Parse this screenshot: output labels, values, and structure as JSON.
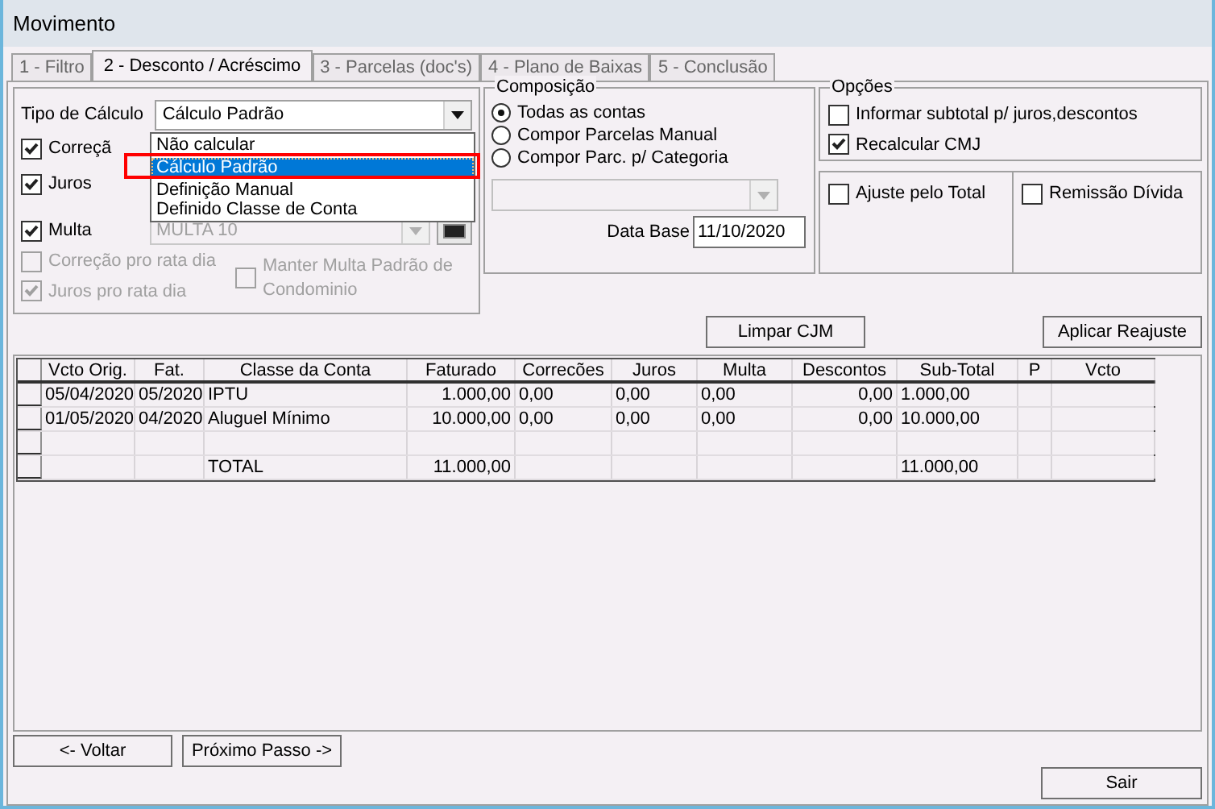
{
  "window": {
    "title": "Movimento"
  },
  "tabs": [
    {
      "label": "1 - Filtro",
      "selected": false
    },
    {
      "label": "2 - Desconto / Acréscimo",
      "selected": true
    },
    {
      "label": "3 - Parcelas (doc's)",
      "selected": false
    },
    {
      "label": "4 - Plano de Baixas",
      "selected": false
    },
    {
      "label": "5 - Conclusão",
      "selected": false
    }
  ],
  "calculo": {
    "label": "Tipo de Cálculo",
    "value": "Cálculo Padrão",
    "options": [
      {
        "label": "Não calcular",
        "selected": false
      },
      {
        "label": "Cálculo Padrão",
        "selected": true
      },
      {
        "label": "Definição Manual",
        "selected": false
      },
      {
        "label": "Definido Classe de Conta",
        "selected": false
      }
    ]
  },
  "checks": [
    {
      "label": "Correçã",
      "checked": true
    },
    {
      "label": "Juros",
      "checked": true
    },
    {
      "label": "Multa",
      "checked": true,
      "select": "MULTA 10"
    }
  ],
  "pro_rata": [
    {
      "label": "Correção pro rata dia",
      "checked": false,
      "disabled": true
    },
    {
      "label": "Juros pro rata dia",
      "checked": true,
      "disabled": true
    }
  ],
  "manter": {
    "label": "Manter Multa Padrão de Condominio",
    "checked": false,
    "disabled": true
  },
  "composicao": {
    "title": "Composição",
    "options": [
      {
        "label": "Todas as contas",
        "selected": true
      },
      {
        "label": "Compor Parcelas Manual",
        "selected": false
      },
      {
        "label": "Compor Parc. p/ Categoria",
        "selected": false
      }
    ],
    "data_base_label": "Data Base",
    "data_base": "11/10/2020"
  },
  "opcoes": {
    "title": "Opções",
    "checks": [
      {
        "label": "Informar subtotal p/ juros,descontos",
        "checked": false
      },
      {
        "label": "Recalcular CMJ",
        "checked": true
      }
    ]
  },
  "ajuste": {
    "label": "Ajuste pelo Total",
    "checked": false
  },
  "remissao": {
    "label": "Remissão Dívida",
    "checked": false
  },
  "limpar_button": "Limpar CJM",
  "aplicar_button": "Aplicar Reajuste",
  "table": {
    "columns": [
      "Vcto Orig.",
      "Fat.",
      "Classe da Conta",
      "Faturado",
      "Correcões",
      "Juros",
      "Multa",
      "Descontos",
      "Sub-Total",
      "P",
      "Vcto"
    ],
    "rows": [
      [
        "05/04/2020",
        "05/2020",
        "IPTU",
        "1.000,00",
        "0,00",
        "0,00",
        "0,00",
        "0,00",
        "1.000,00"
      ],
      [
        "01/05/2020",
        "04/2020",
        "Aluguel Mínimo",
        "10.000,00",
        "0,00",
        "0,00",
        "0,00",
        "0,00",
        "10.000,00"
      ]
    ],
    "total": {
      "label": "TOTAL",
      "faturado": "11.000,00",
      "sub_total": "11.000,00"
    }
  },
  "voltar_button": "<- Voltar",
  "proximo_button": "Próximo Passo ->",
  "sair_button": "Sair"
}
